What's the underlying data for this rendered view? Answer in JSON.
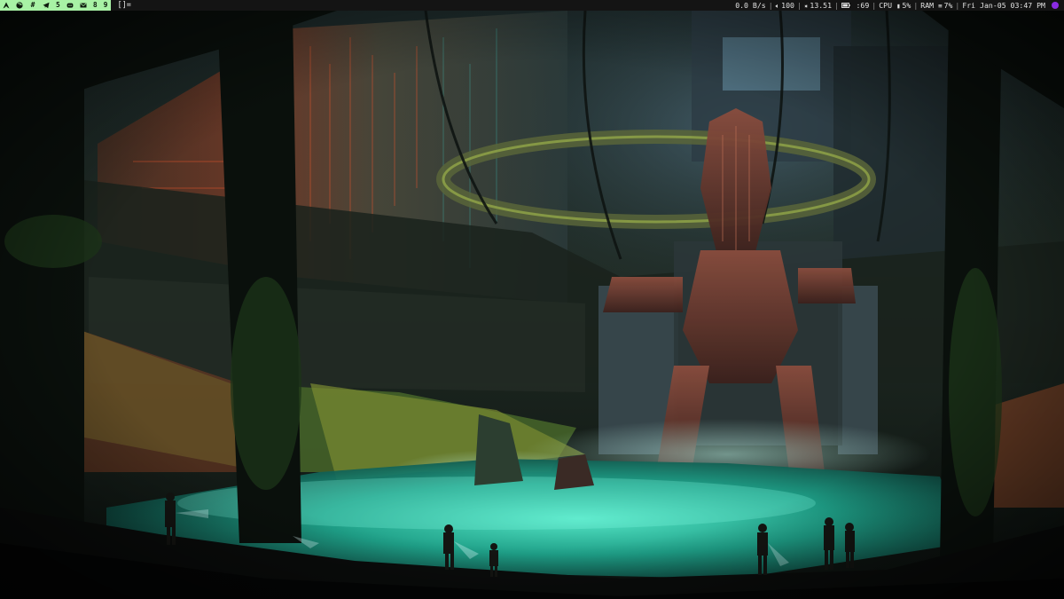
{
  "workspaces": [
    {
      "label": "A",
      "icon": "arch-icon",
      "kind": "icon"
    },
    {
      "label": "",
      "icon": "firefox-icon",
      "kind": "icon"
    },
    {
      "label": "#",
      "icon": "hash-icon",
      "kind": "icon"
    },
    {
      "label": "",
      "icon": "telegram-icon",
      "kind": "icon"
    },
    {
      "label": "5",
      "kind": "number"
    },
    {
      "label": "",
      "icon": "discord-icon",
      "kind": "icon"
    },
    {
      "label": "",
      "icon": "mail-icon",
      "kind": "icon"
    },
    {
      "label": "8",
      "kind": "number"
    },
    {
      "label": "9",
      "kind": "number"
    }
  ],
  "layout_indicator": "[]=",
  "status": {
    "net": "0.0  B/s",
    "volume": "100",
    "brightness": "13.51",
    "battery": ":69",
    "cpu_label": "CPU",
    "cpu_value": "5%",
    "ram_label": "RAM",
    "ram_value": "7%",
    "datetime": "Fri Jan-05 03:47 PM"
  },
  "colors": {
    "bar_bg": "#141414",
    "workspace_active_bg": "#a8f2a5",
    "tray_accent": "#8b2be2",
    "water": "#2fd3b0"
  }
}
